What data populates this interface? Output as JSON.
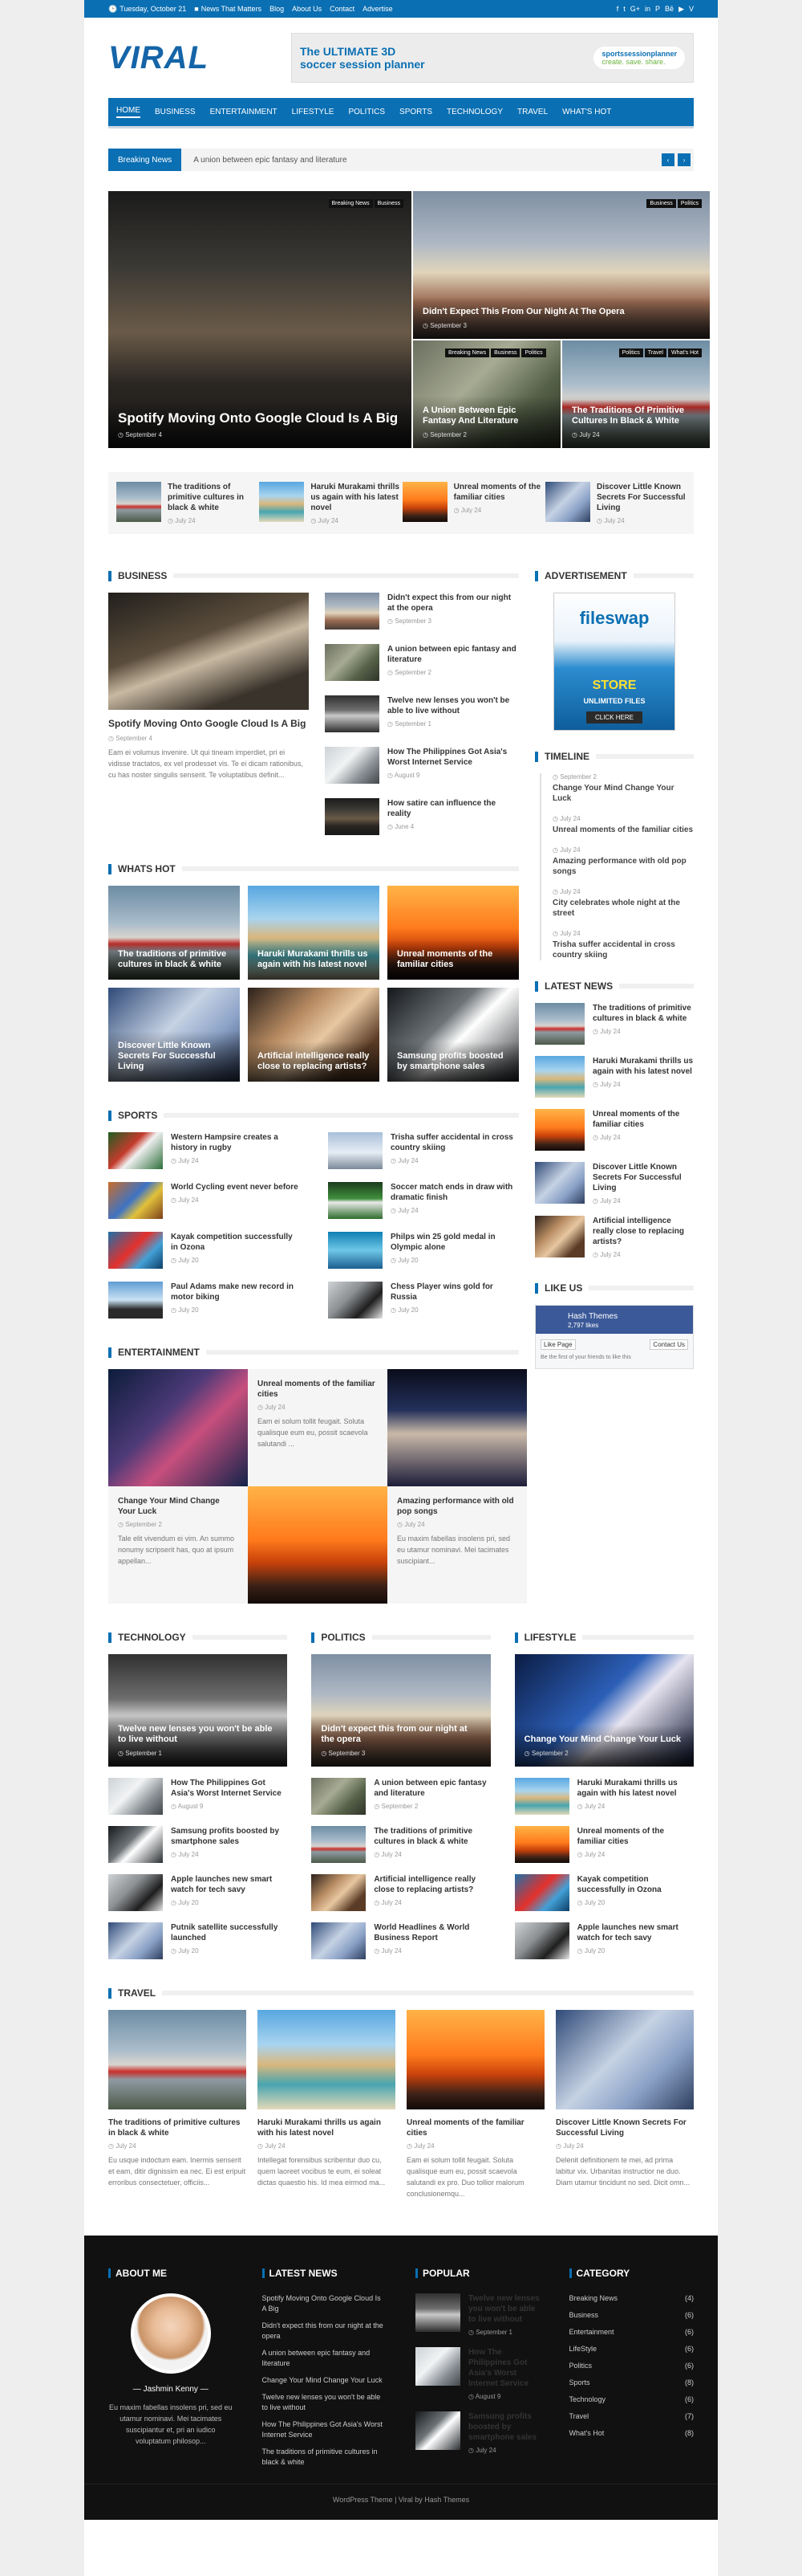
{
  "topbar": {
    "date": "Tuesday, October 21",
    "news": "News That Matters",
    "links": [
      "Blog",
      "About Us",
      "Contact",
      "Advertise"
    ],
    "social": [
      "f",
      "t",
      "G+",
      "in",
      "P",
      "Bē",
      "▶",
      "V"
    ]
  },
  "logo": "VIRAL",
  "banner": {
    "line1": "The ULTIMATE 3D",
    "line2": "soccer session planner",
    "brand": "sportssessionplanner",
    "tagline": "create. save. share."
  },
  "nav": [
    "HOME",
    "BUSINESS",
    "ENTERTAINMENT",
    "LIFESTYLE",
    "POLITICS",
    "SPORTS",
    "TECHNOLOGY",
    "TRAVEL",
    "WHAT'S HOT"
  ],
  "ticker": {
    "label": "Breaking News",
    "text": "A union between epic fantasy and literature"
  },
  "hero": [
    {
      "title": "Spotify Moving Onto Google Cloud Is A Big",
      "date": "September 4",
      "tags": [
        "Breaking News",
        "Business"
      ]
    },
    {
      "title": "Didn't Expect This From Our Night At The Opera",
      "date": "September 3",
      "tags": [
        "Business",
        "Politics"
      ]
    },
    {
      "title": "A Union Between Epic Fantasy And Literature",
      "date": "September 2",
      "tags": [
        "Breaking News",
        "Business",
        "Politics"
      ]
    },
    {
      "title": "The Traditions Of Primitive Cultures In Black & White",
      "date": "July 24",
      "tags": [
        "Politics",
        "Travel",
        "What's Hot"
      ]
    }
  ],
  "strip": [
    {
      "title": "The traditions of primitive cultures in black & white",
      "date": "July 24"
    },
    {
      "title": "Haruki Murakami thrills us again with his latest novel",
      "date": "July 24"
    },
    {
      "title": "Unreal moments of the familiar cities",
      "date": "July 24"
    },
    {
      "title": "Discover Little Known Secrets For Successful Living",
      "date": "July 24"
    }
  ],
  "sections": {
    "business": "BUSINESS",
    "whatshot": "WHATS HOT",
    "sports": "SPORTS",
    "entertainment": "ENTERTAINMENT",
    "technology": "TECHNOLOGY",
    "politics": "POLITICS",
    "lifestyle": "LIFESTYLE",
    "travel": "TRAVEL",
    "advertisement": "ADVERTISEMENT",
    "timeline": "TIMELINE",
    "latest": "LATEST NEWS",
    "likeus": "LIKE US"
  },
  "business": {
    "main": {
      "title": "Spotify Moving Onto Google Cloud Is A Big",
      "date": "September 4",
      "excerpt": "Eam ei volumus invenire. Ut qui tineam imperdiet, pri ei vidisse tractatos, ex vel prodesset vis. Te ei dicam rationibus, cu has noster singulis senserit. Te voluptatibus definit..."
    },
    "list": [
      {
        "title": "Didn't expect this from our night at the opera",
        "date": "September 3"
      },
      {
        "title": "A union between epic fantasy and literature",
        "date": "September 2"
      },
      {
        "title": "Twelve new lenses you won't be able to live without",
        "date": "September 1"
      },
      {
        "title": "How The Philippines Got Asia's Worst Internet Service",
        "date": "August 9"
      },
      {
        "title": "How satire can influence the reality",
        "date": "June 4"
      }
    ]
  },
  "whatshot": [
    "The traditions of primitive cultures in black & white",
    "Haruki Murakami thrills us again with his latest novel",
    "Unreal moments of the familiar cities",
    "Discover Little Known Secrets For Successful Living",
    "Artificial intelligence really close to replacing artists?",
    "Samsung profits boosted by smartphone sales"
  ],
  "sports": [
    {
      "title": "Western Hampsire creates a history in rugby",
      "date": "July 24"
    },
    {
      "title": "Trisha suffer accidental in cross country skiing",
      "date": "July 24"
    },
    {
      "title": "World Cycling event never before",
      "date": "July 24"
    },
    {
      "title": "Soccer match ends in draw with dramatic finish",
      "date": "July 24"
    },
    {
      "title": "Kayak competition successfully in Ozona",
      "date": "July 20"
    },
    {
      "title": "Philps win 25 gold medal in Olympic alone",
      "date": "July 20"
    },
    {
      "title": "Paul Adams make new record in motor biking",
      "date": "July 20"
    },
    {
      "title": "Chess Player wins gold for Russia",
      "date": "July 20"
    }
  ],
  "entertainment": [
    {
      "title": "Unreal moments of the familiar cities",
      "date": "July 24",
      "excerpt": "Eam ei solum tollit feugait. Soluta qualisque eum eu, possit scaevola salutandi ..."
    },
    {
      "title": "Change Your Mind Change Your Luck",
      "date": "September 2",
      "excerpt": "Tale elit vivendum ei vim. An summo nonumy scripserit has, quo at ipsum appellan..."
    },
    {
      "title": "Amazing performance with old pop songs",
      "date": "July 24",
      "excerpt": "Eu maxim fabellas insolens pri, sed eu utamur nominavi. Mei tacimates suscipiant..."
    }
  ],
  "advertisement": {
    "brand": "fileswap",
    "store": "STORE",
    "sub": "UNLIMITED FILES",
    "cta": "CLICK HERE"
  },
  "timeline": [
    {
      "date": "September 2",
      "title": "Change Your Mind Change Your Luck"
    },
    {
      "date": "July 24",
      "title": "Unreal moments of the familiar cities"
    },
    {
      "date": "July 24",
      "title": "Amazing performance with old pop songs"
    },
    {
      "date": "July 24",
      "title": "City celebrates whole night at the street"
    },
    {
      "date": "July 24",
      "title": "Trisha suffer accidental in cross country skiing"
    }
  ],
  "latest": [
    {
      "title": "The traditions of primitive cultures in black & white",
      "date": "July 24"
    },
    {
      "title": "Haruki Murakami thrills us again with his latest novel",
      "date": "July 24"
    },
    {
      "title": "Unreal moments of the familiar cities",
      "date": "July 24"
    },
    {
      "title": "Discover Little Known Secrets For Successful Living",
      "date": "July 24"
    },
    {
      "title": "Artificial intelligence really close to replacing artists?",
      "date": "July 24"
    }
  ],
  "likeus": {
    "page": "Hash Themes",
    "likes": "2,797 likes",
    "like": "Like Page",
    "contact": "Contact Us",
    "friends": "Be the first of your friends to like this"
  },
  "technology": {
    "feat": {
      "title": "Twelve new lenses you won't be able to live without",
      "date": "September 1"
    },
    "list": [
      {
        "title": "How The Philippines Got Asia's Worst Internet Service",
        "date": "August 9"
      },
      {
        "title": "Samsung profits boosted by smartphone sales",
        "date": "July 24"
      },
      {
        "title": "Apple launches new smart watch for tech savy",
        "date": "July 20"
      },
      {
        "title": "Putnik satellite successfully launched",
        "date": "July 20"
      }
    ]
  },
  "politics": {
    "feat": {
      "title": "Didn't expect this from our night at the opera",
      "date": "September 3"
    },
    "list": [
      {
        "title": "A union between epic fantasy and literature",
        "date": "September 2"
      },
      {
        "title": "The traditions of primitive cultures in black & white",
        "date": "July 24"
      },
      {
        "title": "Artificial intelligence really close to replacing artists?",
        "date": "July 24"
      },
      {
        "title": "World Headlines & World Business Report",
        "date": "July 24"
      }
    ]
  },
  "lifestyle": {
    "feat": {
      "title": "Change Your Mind Change Your Luck",
      "date": "September 2"
    },
    "list": [
      {
        "title": "Haruki Murakami thrills us again with his latest novel",
        "date": "July 24"
      },
      {
        "title": "Unreal moments of the familiar cities",
        "date": "July 24"
      },
      {
        "title": "Kayak competition successfully in Ozona",
        "date": "July 20"
      },
      {
        "title": "Apple launches new smart watch for tech savy",
        "date": "July 20"
      }
    ]
  },
  "travel": [
    {
      "title": "The traditions of primitive cultures in black & white",
      "date": "July 24",
      "excerpt": "Eu usque indoctum eam. Inermis senserit et eam, ditir dignissim ea nec. Ei est eripuit erroribus consectetuer, officiis..."
    },
    {
      "title": "Haruki Murakami thrills us again with his latest novel",
      "date": "July 24",
      "excerpt": "Intellegat forensibus scribentur duo cu, quem laoreet vocibus te eum, ei soleat dictas quaestio his. Id mea eirmod ma..."
    },
    {
      "title": "Unreal moments of the familiar cities",
      "date": "July 24",
      "excerpt": "Eam ei solum tollit feugait. Soluta qualisque eum eu, possit scaevola salutandi ex pro. Duo tollior malorum conclusionemqu..."
    },
    {
      "title": "Discover Little Known Secrets For Successful Living",
      "date": "July 24",
      "excerpt": "Delenit definitionem te mei, ad prima labitur vix. Urbanitas instructior ne duo. Diam utamur tincidunt no sed. Dicit omn..."
    }
  ],
  "footer": {
    "about": {
      "title": "ABOUT ME",
      "name": "Jashmin Kenny",
      "text": "Eu maxim fabellas insolens pri, sed eu utamur nominavi. Mei tacimates suscipiantur et, pri an iudico voluptatum philosop..."
    },
    "latest": {
      "title": "LATEST NEWS",
      "items": [
        "Spotify Moving Onto Google Cloud Is A Big",
        "Didn't expect this from our night at the opera",
        "A union between epic fantasy and literature",
        "Change Your Mind Change Your Luck",
        "Twelve new lenses you won't be able to live without",
        "How The Philippines Got Asia's Worst Internet Service",
        "The traditions of primitive cultures in black & white"
      ]
    },
    "popular": {
      "title": "POPULAR",
      "items": [
        {
          "title": "Twelve new lenses you won't be able to live without",
          "date": "September 1"
        },
        {
          "title": "How The Philippines Got Asia's Worst Internet Service",
          "date": "August 9"
        },
        {
          "title": "Samsung profits boosted by smartphone sales",
          "date": "July 24"
        }
      ]
    },
    "category": {
      "title": "CATEGORY",
      "items": [
        {
          "name": "Breaking News",
          "count": "(4)"
        },
        {
          "name": "Business",
          "count": "(6)"
        },
        {
          "name": "Entertainment",
          "count": "(6)"
        },
        {
          "name": "LifeStyle",
          "count": "(6)"
        },
        {
          "name": "Politics",
          "count": "(6)"
        },
        {
          "name": "Sports",
          "count": "(8)"
        },
        {
          "name": "Technology",
          "count": "(6)"
        },
        {
          "name": "Travel",
          "count": "(7)"
        },
        {
          "name": "What's Hot",
          "count": "(8)"
        }
      ]
    }
  },
  "copyright": "WordPress Theme | Viral by Hash Themes"
}
